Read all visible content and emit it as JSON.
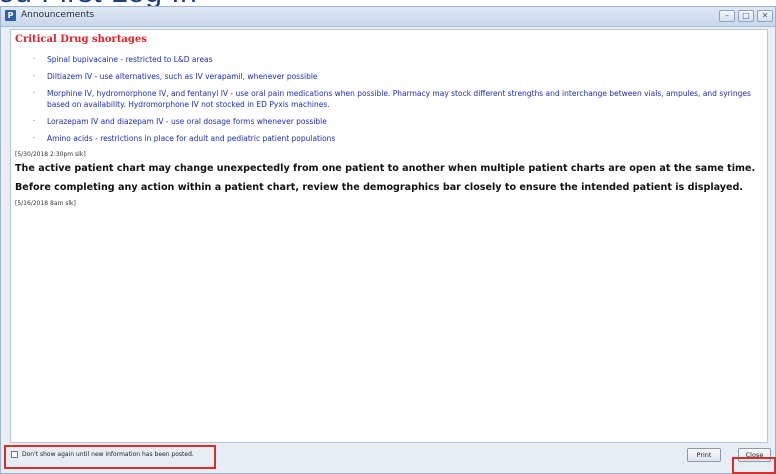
{
  "background": {
    "partial_heading": "ou First Log In"
  },
  "window": {
    "title": "Announcements",
    "controls": {
      "minimize": "–",
      "maximize": "□",
      "close": "✕"
    }
  },
  "announcement": {
    "section_title": "Critical Drug shortages",
    "bullets": [
      "Spinal bupivacaine - restricted to L&D areas",
      "Diltiazem IV - use alternatives, such as IV verapamil, whenever possible",
      "Morphine IV, hydromorphone IV, and fentanyl IV - use oral pain medications when possible. Pharmacy may stock different strengths and interchange between vials, ampules, and syringes based on availability. Hydromorphone IV not stocked in ED Pyxis machines.",
      "Lorazepam IV and diazepam IV - use oral dosage forms whenever possible",
      "Amino acids - restrictions in place for adult and pediatric patient populations"
    ],
    "stamp1": "[5/30/2018 2:30pm slk]",
    "alert_line1": "The active patient chart may change unexpectedly from one patient to another when multiple patient charts are open at the same time.",
    "alert_line2": "Before completing any action within a patient chart, review the demographics bar closely to ensure the intended patient is displayed.",
    "stamp2": "[5/16/2018 8am slk]"
  },
  "footer": {
    "checkbox_label": "Don't show again until new information has been posted.",
    "print_label": "Print",
    "close_label": "Close"
  },
  "colors": {
    "section_title": "#e0202a",
    "bullet_text": "#1f2dab",
    "highlight_box": "#d3302b"
  }
}
